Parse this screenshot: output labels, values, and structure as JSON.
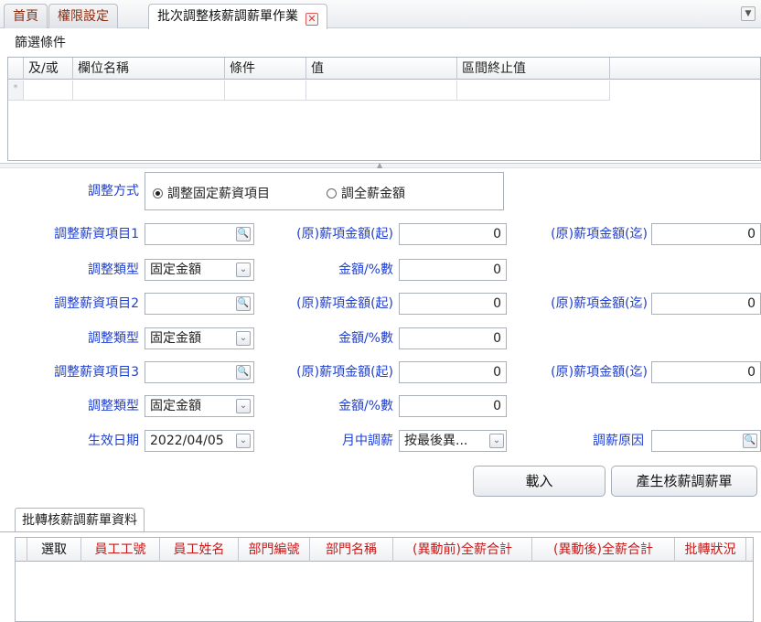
{
  "tabs": {
    "home": "首頁",
    "permissions": "權限設定",
    "batch": "批次調整核薪調薪單作業",
    "close_icon": "close-icon",
    "menu_icon": "chevron-down-icon"
  },
  "filter": {
    "title": "篩選條件",
    "columns": [
      "及/或",
      "欄位名稱",
      "條件",
      "值",
      "區間終止值"
    ],
    "new_row_marker": "*"
  },
  "form": {
    "method_label": "調整方式",
    "method_options": [
      "調整固定薪資項目",
      "調全薪金額"
    ],
    "method_selected": 0,
    "rows": [
      {
        "item_label": "調整薪資項目1",
        "item_value": "",
        "from_label": "(原)薪項金額(起)",
        "from_value": "0",
        "to_label": "(原)薪項金額(迄)",
        "to_value": "0",
        "type_label": "調整類型",
        "type_value": "固定金額",
        "amount_label": "金額/%數",
        "amount_value": "0"
      },
      {
        "item_label": "調整薪資項目2",
        "item_value": "",
        "from_label": "(原)薪項金額(起)",
        "from_value": "0",
        "to_label": "(原)薪項金額(迄)",
        "to_value": "0",
        "type_label": "調整類型",
        "type_value": "固定金額",
        "amount_label": "金額/%數",
        "amount_value": "0"
      },
      {
        "item_label": "調整薪資項目3",
        "item_value": "",
        "from_label": "(原)薪項金額(起)",
        "from_value": "0",
        "to_label": "(原)薪項金額(迄)",
        "to_value": "0",
        "type_label": "調整類型",
        "type_value": "固定金額",
        "amount_label": "金額/%數",
        "amount_value": "0"
      }
    ],
    "effective_label": "生效日期",
    "effective_value": "2022/04/05",
    "midmonth_label": "月中調薪",
    "midmonth_value": "按最後異...",
    "reason_label": "調薪原因",
    "reason_value": ""
  },
  "actions": {
    "load": "載入",
    "generate": "產生核薪調薪單"
  },
  "result": {
    "tab": "批轉核薪調薪單資料",
    "columns": [
      "選取",
      "員工工號",
      "員工姓名",
      "部門編號",
      "部門名稱",
      "(異動前)全薪合計",
      "(異動後)全薪合計",
      "批轉狀況"
    ]
  }
}
